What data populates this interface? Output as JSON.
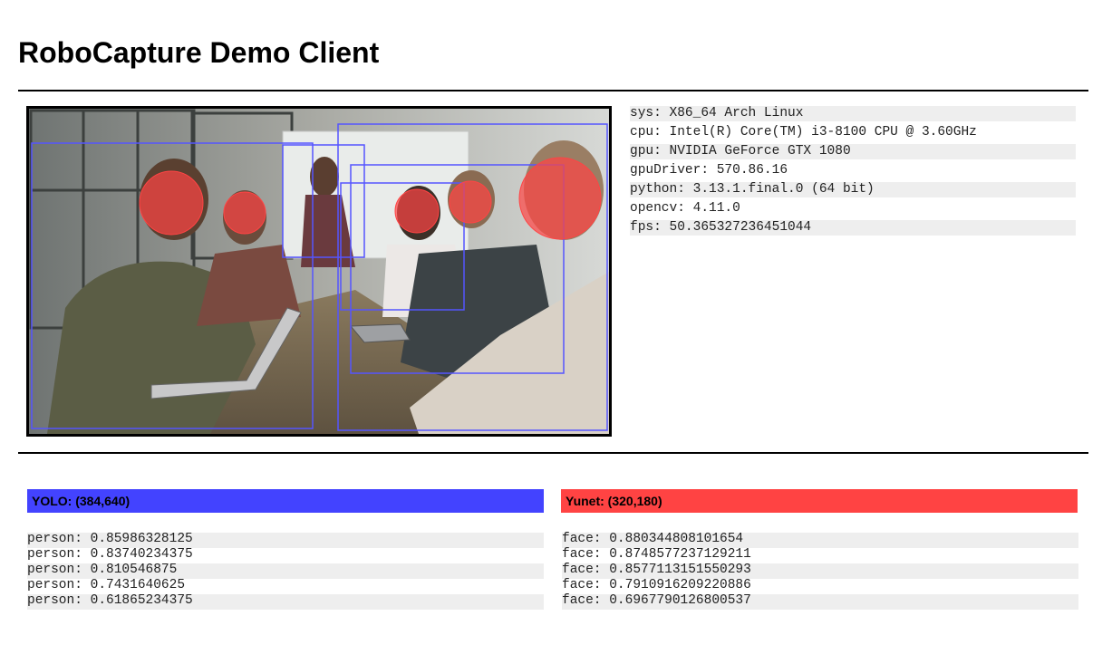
{
  "page": {
    "title": "RoboCapture Demo Client"
  },
  "system_info": [
    "sys: X86_64 Arch Linux",
    "cpu: Intel(R) Core(TM) i3-8100 CPU @ 3.60GHz",
    "gpu: NVIDIA GeForce GTX 1080",
    "gpuDriver: 570.86.16",
    "python: 3.13.1.final.0 (64 bit)",
    "opencv: 4.11.0",
    "fps: 50.365327236451044"
  ],
  "yolo": {
    "label": "YOLO: (384,640)",
    "color": "#4343ff",
    "detections": [
      "person: 0.85986328125",
      "person: 0.83740234375",
      "person: 0.810546875",
      "person: 0.7431640625",
      "person: 0.61865234375"
    ]
  },
  "yunet": {
    "label": "Yunet: (320,180)",
    "color": "#ff4343",
    "detections": [
      "face: 0.880344808101654",
      "face: 0.8748577237129211",
      "face: 0.8577113151550293",
      "face: 0.7910916209220886",
      "face: 0.6967790126800537"
    ]
  },
  "colors": {
    "person_box": "#5555ff",
    "face_marker": "#ff4444"
  }
}
